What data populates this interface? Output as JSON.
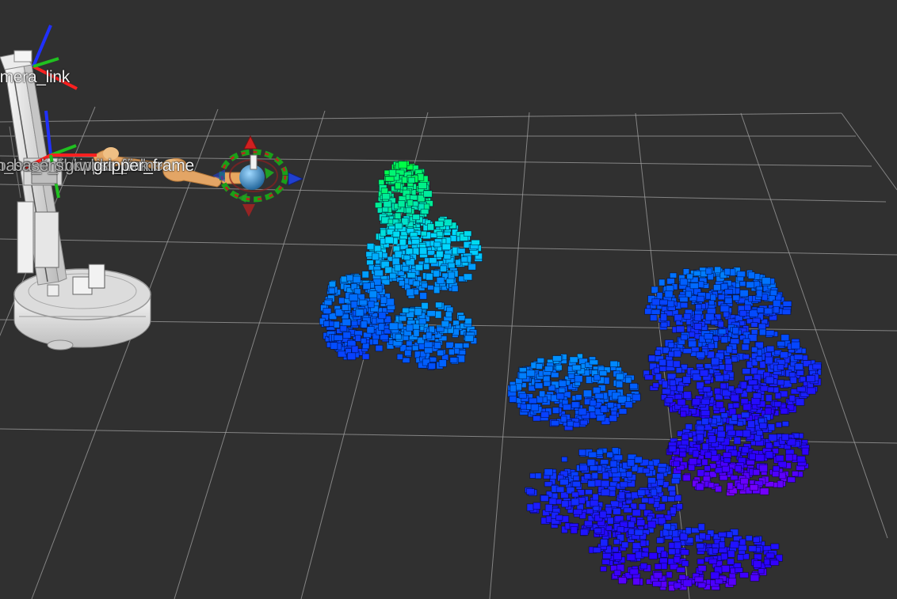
{
  "view": {
    "background_color": "#303030",
    "grid_color": "#a0a0a0"
  },
  "frame_labels": {
    "camera_link": "camera_link",
    "gripper_frame": "gripper_frame",
    "overlapping": [
      "base_link",
      "arm_base_link",
      "shoulder_link",
      "gripper_link",
      "wrist_frame"
    ]
  },
  "point_cloud": {
    "color_scale": [
      "#00ff40",
      "#00d8ff",
      "#0050ff",
      "#2a00ff",
      "#a000ff"
    ]
  },
  "interactive_marker": {
    "ring_color": "#19a019",
    "ring_alt_color": "#c02020",
    "arrow_colors": {
      "x": "#d02020",
      "y": "#20a020",
      "z": "#2040d0"
    }
  },
  "axis_colors": {
    "x": "#ff2020",
    "y": "#20c020",
    "z": "#2030ff"
  },
  "robot": {
    "body_color": "#e6e6e6",
    "link_color": "#e8a860"
  }
}
